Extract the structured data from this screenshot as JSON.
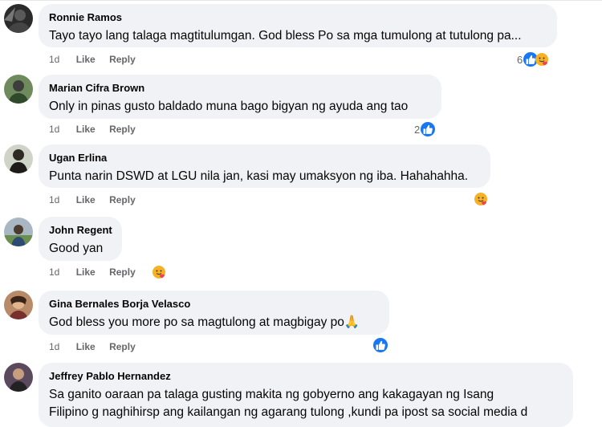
{
  "colors": {
    "bubble": "#f0f2f5",
    "meta_text": "#65676b",
    "like_blue": "#1877f2",
    "care_yellow": "#f7b125"
  },
  "action_labels": {
    "like": "Like",
    "reply": "Reply"
  },
  "comments": [
    {
      "author": "Ronnie Ramos",
      "text": "Tayo tayo lang talaga magtitulumgan. God bless Po sa mga tumulong at tutulong pa...",
      "time": "1d",
      "reaction_count": "6",
      "reactions": [
        "like-icon",
        "care-icon"
      ]
    },
    {
      "author": "Marian Cifra Brown",
      "text": "Only in pinas gusto baldado muna bago bigyan ng ayuda ang tao",
      "time": "1d",
      "reaction_count": "2",
      "reactions": [
        "like-icon"
      ]
    },
    {
      "author": "Ugan Erlina",
      "text": "Punta narin DSWD at LGU nila jan, kasi may umaksyon ng iba. Hahahahha.",
      "time": "1d",
      "reaction_count": "",
      "reactions": [
        "care-icon"
      ]
    },
    {
      "author": "John Regent",
      "text": "Good yan",
      "time": "1d",
      "reaction_count": "",
      "reactions": [
        "care-icon"
      ]
    },
    {
      "author": "Gina Bernales Borja Velasco",
      "text": "God bless you more po sa magtulong at magbigay po",
      "emoji": "🙏",
      "time": "1d",
      "reaction_count": "",
      "reactions": [
        "like-icon"
      ]
    },
    {
      "author": "Jeffrey Pablo Hernandez",
      "text_lines": [
        "Sa ganito oaraan pa talaga gusting makita ng gobyerno ang kakagayan ng Isang",
        "Filipino g naghihirsp ang kailangan ng agarang tulong ,kundi pa ipost sa social media d"
      ]
    }
  ]
}
